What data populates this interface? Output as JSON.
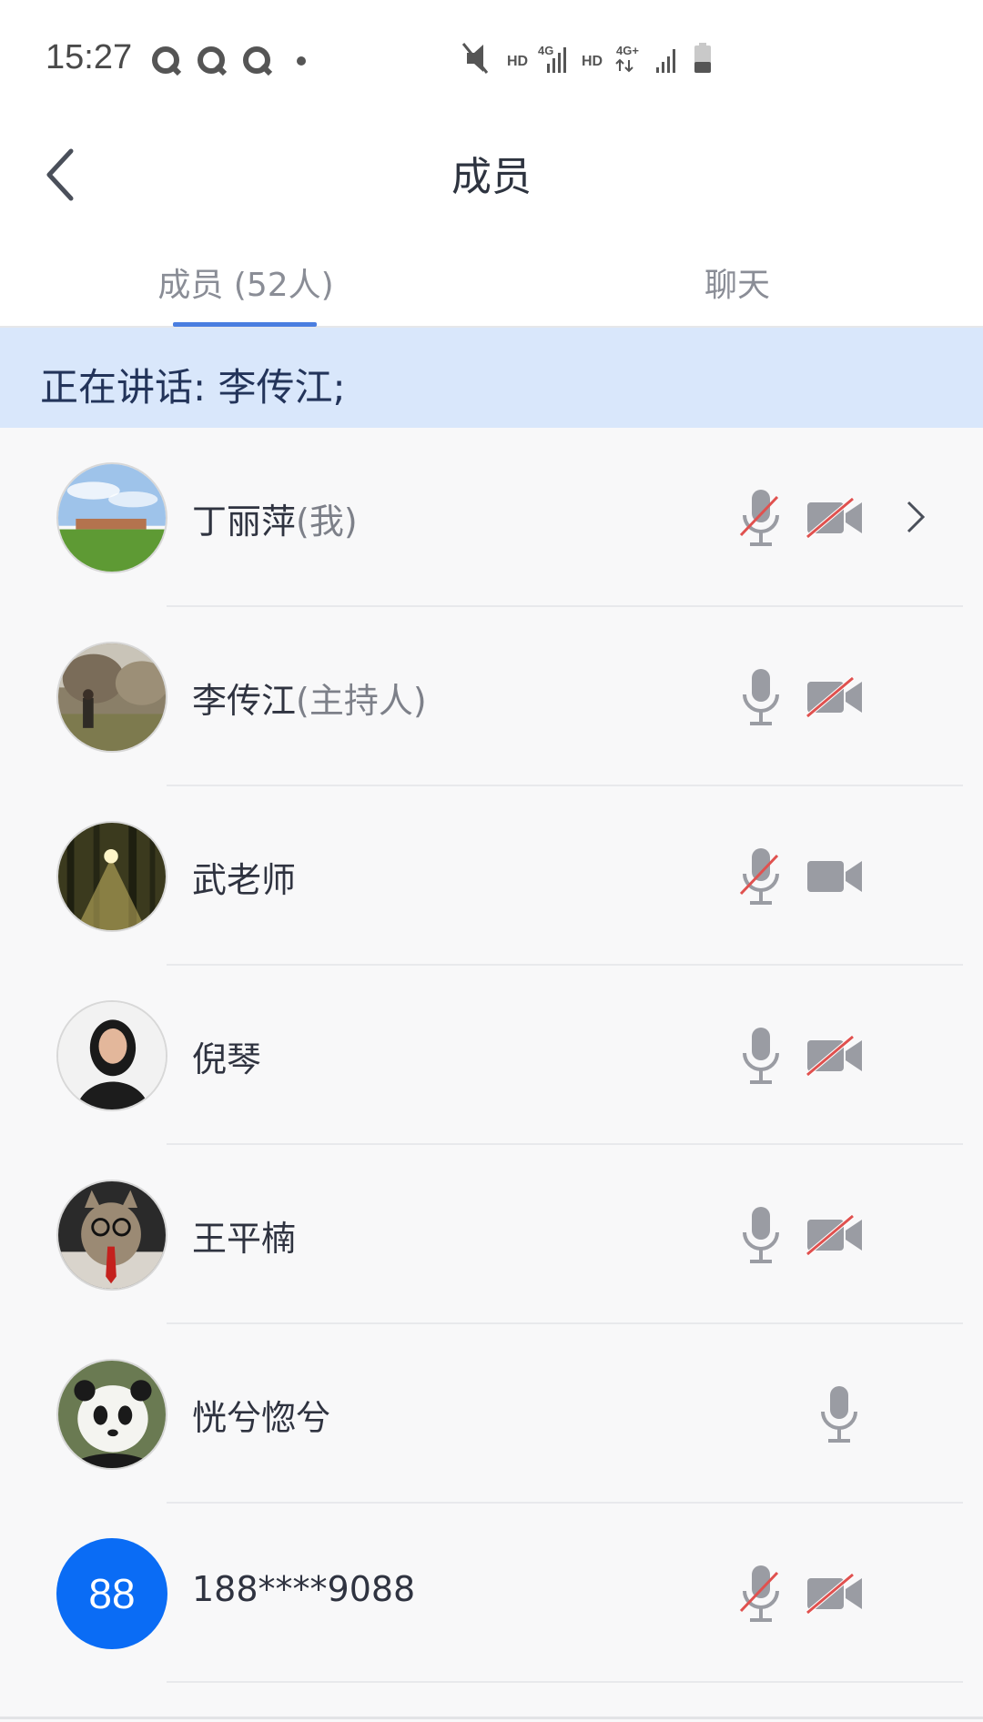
{
  "status_bar": {
    "time": "15:27"
  },
  "header": {
    "title": "成员"
  },
  "tabs": [
    {
      "label": "成员 (52人)",
      "active": true
    },
    {
      "label": "聊天",
      "active": false
    }
  ],
  "speaking_banner": {
    "text": "正在讲话: 李传江;"
  },
  "members": [
    {
      "name": "丁丽萍",
      "role": "(我)",
      "avatar": "landscape-photo",
      "mic_muted": true,
      "camera_off": true,
      "has_chevron": true
    },
    {
      "name": "李传江",
      "role": "(主持人)",
      "avatar": "person-in-park-photo",
      "mic_muted": false,
      "camera_off": true,
      "has_chevron": false
    },
    {
      "name": "武老师",
      "role": "",
      "avatar": "forest-sunlight-photo",
      "mic_muted": true,
      "camera_off": false,
      "has_chevron": false
    },
    {
      "name": "倪琴",
      "role": "",
      "avatar": "woman-portrait-photo",
      "mic_muted": false,
      "camera_off": true,
      "has_chevron": false
    },
    {
      "name": "王平楠",
      "role": "",
      "avatar": "cat-with-tie-photo",
      "mic_muted": false,
      "camera_off": true,
      "has_chevron": false
    },
    {
      "name": "恍兮惚兮",
      "role": "",
      "avatar": "panda-photo",
      "mic_muted": false,
      "camera_off": null,
      "has_chevron": false
    },
    {
      "name": "188****9088",
      "role": "",
      "avatar_initials": "88",
      "avatar_color": "#0a6cf5",
      "mic_muted": true,
      "camera_off": true,
      "has_chevron": false
    }
  ],
  "colors": {
    "accent": "#4a7ee0",
    "banner_bg": "#d9e7fb",
    "muted_slash": "#e0514f",
    "icon_gray": "#9a9ca3"
  }
}
